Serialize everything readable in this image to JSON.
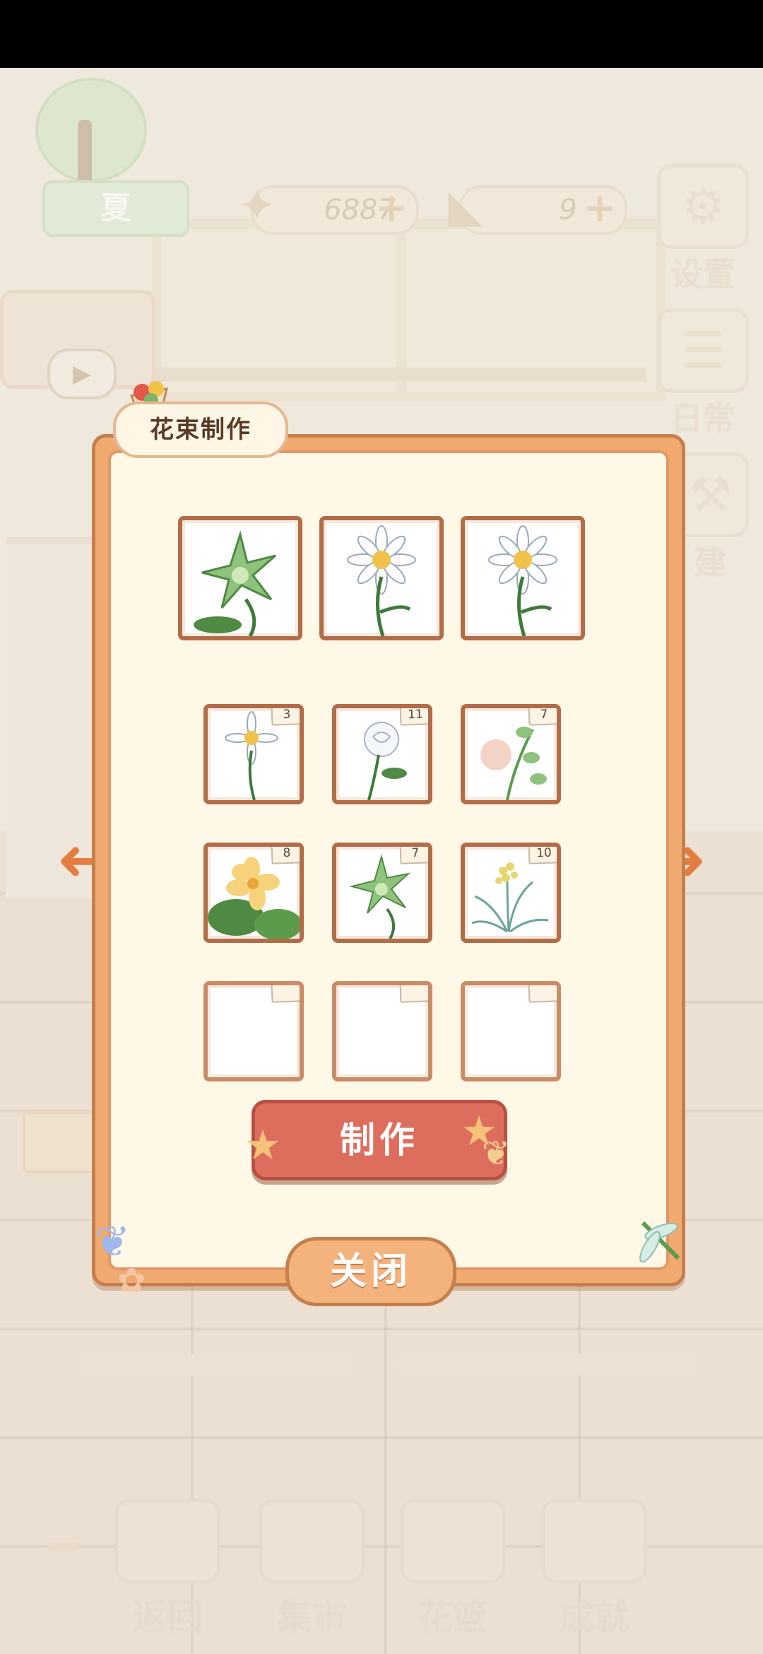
{
  "hud": {
    "season_label": "夏",
    "fish_bones": "6887",
    "cheese": "9",
    "settings_label": "设置",
    "daily_label": "日常",
    "build_label": "建"
  },
  "dialog": {
    "title": "花束制作",
    "make_label": "制作",
    "close_label": "关闭",
    "recipe_slots": [
      "green-star-flower",
      "white-daisy",
      "white-daisy"
    ],
    "inventory": [
      {
        "flower": "white-daisy",
        "count": "3"
      },
      {
        "flower": "white-rose",
        "count": "11"
      },
      {
        "flower": "pink-bud",
        "count": "7"
      },
      {
        "flower": "yellow-plumeria",
        "count": "8"
      },
      {
        "flower": "green-star-flower",
        "count": "7"
      },
      {
        "flower": "mimosa",
        "count": "10"
      },
      {
        "flower": "",
        "count": ""
      },
      {
        "flower": "",
        "count": ""
      },
      {
        "flower": "",
        "count": ""
      }
    ]
  },
  "nav": {
    "back": "返回",
    "market": "集市",
    "basket": "花篮",
    "achievement": "成就"
  },
  "icons": [
    "fish-bone-icon",
    "cheese-icon",
    "plus-icon",
    "gear-icon",
    "daily-note-icon",
    "play-icon",
    "arrow-left-icon",
    "arrow-right-icon",
    "butterfly-icon",
    "dragonfly-icon",
    "bouquet-icon"
  ]
}
